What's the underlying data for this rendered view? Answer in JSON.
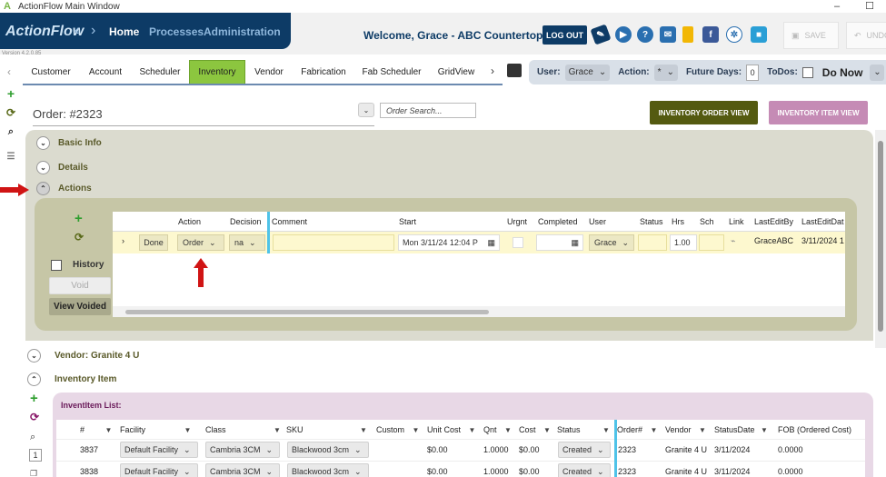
{
  "window": {
    "title": "ActionFlow Main Window",
    "version": "Version 4.2.0.85"
  },
  "brand": {
    "name": "ActionFlow",
    "nav": [
      "Home",
      "Processes",
      "Administration"
    ]
  },
  "header": {
    "welcome": "Welcome, Grace - ABC Countertops",
    "logout": "LOG OUT",
    "save": "SAVE",
    "undo": "UNDO",
    "icons": [
      "tag-icon",
      "play-icon",
      "help-icon",
      "mail-icon",
      "chart-icon",
      "facebook-icon",
      "network-icon",
      "video-icon"
    ],
    "colors": {
      "navy": "#0d3b66",
      "green": "#8cc63f"
    }
  },
  "tabs": [
    "Customer",
    "Account",
    "Scheduler",
    "Inventory",
    "Vendor",
    "Fabrication",
    "Fab Scheduler",
    "GridView"
  ],
  "active_tab": "Inventory",
  "filters": {
    "user_label": "User:",
    "user_value": "Grace",
    "action_label": "Action:",
    "action_value": "*",
    "future_label": "Future Days:",
    "future_value": "0",
    "todos_label": "ToDos:",
    "do_now": "Do Now"
  },
  "order": {
    "title": "Order:  #2323",
    "search_placeholder": "Order Search...",
    "inv_order_btn": "INVENTORY ORDER VIEW",
    "inv_item_btn": "INVENTORY ITEM VIEW"
  },
  "sections": {
    "basic": "Basic Info",
    "details": "Details",
    "actions": "Actions",
    "vendor": "Vendor: Granite 4 U",
    "inventory_item": "Inventory Item"
  },
  "actions_side": {
    "history": "History",
    "void": "Void",
    "view_voided": "View Voided"
  },
  "action_grid": {
    "headers": [
      "Action",
      "Decision",
      "Comment",
      "Start",
      "Urgnt",
      "Completed",
      "User",
      "Status",
      "Hrs",
      "Sch",
      "Link",
      "LastEditBy",
      "LastEditDat"
    ],
    "row": {
      "done": "Done",
      "action": "Order",
      "decision": "na",
      "comment": "",
      "start": "Mon 3/11/24 12:04 P",
      "completed": "",
      "user": "Grace",
      "status": "",
      "hrs": "1.00",
      "sch": "",
      "last_edit_by": "GraceABC",
      "last_edit_date": "3/11/2024 1"
    }
  },
  "inv_list": {
    "title": "InventItem List:",
    "page": "1",
    "headers": [
      "#",
      "Facility",
      "Class",
      "SKU",
      "Custom",
      "Unit Cost",
      "Qnt",
      "Cost",
      "Status",
      "Order#",
      "Vendor",
      "StatusDate",
      "FOB (Ordered Cost)"
    ],
    "rows": [
      {
        "num": "3837",
        "facility": "Default Facility",
        "class": "Cambria 3CM",
        "sku": "Blackwood 3cm",
        "custom": "",
        "unit_cost": "$0.00",
        "qnt": "1.0000",
        "cost": "$0.00",
        "status": "Created",
        "order": "2323",
        "vendor": "Granite 4 U",
        "status_date": "3/11/2024",
        "fob": "0.0000"
      },
      {
        "num": "3838",
        "facility": "Default Facility",
        "class": "Cambria 3CM",
        "sku": "Blackwood 3cm",
        "custom": "",
        "unit_cost": "$0.00",
        "qnt": "1.0000",
        "cost": "$0.00",
        "status": "Created",
        "order": "2323",
        "vendor": "Granite 4 U",
        "status_date": "3/11/2024",
        "fob": "0.0000"
      }
    ]
  }
}
